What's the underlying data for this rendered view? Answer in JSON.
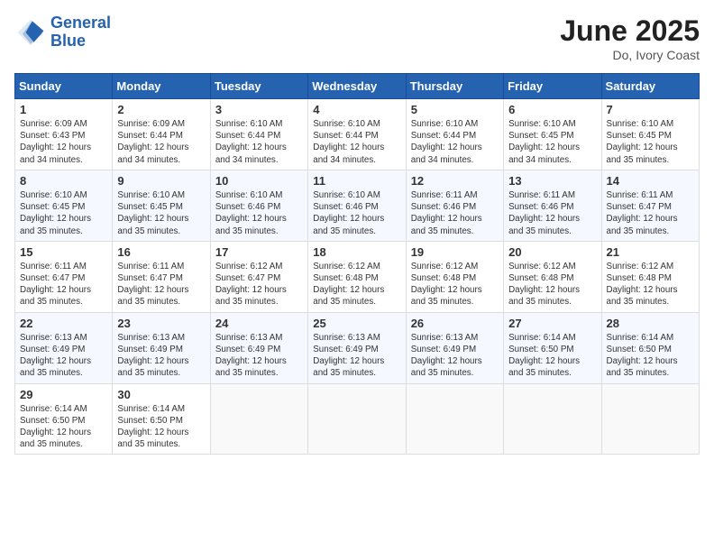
{
  "header": {
    "logo_line1": "General",
    "logo_line2": "Blue",
    "month": "June 2025",
    "location": "Do, Ivory Coast"
  },
  "weekdays": [
    "Sunday",
    "Monday",
    "Tuesday",
    "Wednesday",
    "Thursday",
    "Friday",
    "Saturday"
  ],
  "weeks": [
    [
      {
        "day": "1",
        "sunrise": "6:09 AM",
        "sunset": "6:43 PM",
        "daylight": "12 hours and 34 minutes."
      },
      {
        "day": "2",
        "sunrise": "6:09 AM",
        "sunset": "6:44 PM",
        "daylight": "12 hours and 34 minutes."
      },
      {
        "day": "3",
        "sunrise": "6:10 AM",
        "sunset": "6:44 PM",
        "daylight": "12 hours and 34 minutes."
      },
      {
        "day": "4",
        "sunrise": "6:10 AM",
        "sunset": "6:44 PM",
        "daylight": "12 hours and 34 minutes."
      },
      {
        "day": "5",
        "sunrise": "6:10 AM",
        "sunset": "6:44 PM",
        "daylight": "12 hours and 34 minutes."
      },
      {
        "day": "6",
        "sunrise": "6:10 AM",
        "sunset": "6:45 PM",
        "daylight": "12 hours and 34 minutes."
      },
      {
        "day": "7",
        "sunrise": "6:10 AM",
        "sunset": "6:45 PM",
        "daylight": "12 hours and 35 minutes."
      }
    ],
    [
      {
        "day": "8",
        "sunrise": "6:10 AM",
        "sunset": "6:45 PM",
        "daylight": "12 hours and 35 minutes."
      },
      {
        "day": "9",
        "sunrise": "6:10 AM",
        "sunset": "6:45 PM",
        "daylight": "12 hours and 35 minutes."
      },
      {
        "day": "10",
        "sunrise": "6:10 AM",
        "sunset": "6:46 PM",
        "daylight": "12 hours and 35 minutes."
      },
      {
        "day": "11",
        "sunrise": "6:10 AM",
        "sunset": "6:46 PM",
        "daylight": "12 hours and 35 minutes."
      },
      {
        "day": "12",
        "sunrise": "6:11 AM",
        "sunset": "6:46 PM",
        "daylight": "12 hours and 35 minutes."
      },
      {
        "day": "13",
        "sunrise": "6:11 AM",
        "sunset": "6:46 PM",
        "daylight": "12 hours and 35 minutes."
      },
      {
        "day": "14",
        "sunrise": "6:11 AM",
        "sunset": "6:47 PM",
        "daylight": "12 hours and 35 minutes."
      }
    ],
    [
      {
        "day": "15",
        "sunrise": "6:11 AM",
        "sunset": "6:47 PM",
        "daylight": "12 hours and 35 minutes."
      },
      {
        "day": "16",
        "sunrise": "6:11 AM",
        "sunset": "6:47 PM",
        "daylight": "12 hours and 35 minutes."
      },
      {
        "day": "17",
        "sunrise": "6:12 AM",
        "sunset": "6:47 PM",
        "daylight": "12 hours and 35 minutes."
      },
      {
        "day": "18",
        "sunrise": "6:12 AM",
        "sunset": "6:48 PM",
        "daylight": "12 hours and 35 minutes."
      },
      {
        "day": "19",
        "sunrise": "6:12 AM",
        "sunset": "6:48 PM",
        "daylight": "12 hours and 35 minutes."
      },
      {
        "day": "20",
        "sunrise": "6:12 AM",
        "sunset": "6:48 PM",
        "daylight": "12 hours and 35 minutes."
      },
      {
        "day": "21",
        "sunrise": "6:12 AM",
        "sunset": "6:48 PM",
        "daylight": "12 hours and 35 minutes."
      }
    ],
    [
      {
        "day": "22",
        "sunrise": "6:13 AM",
        "sunset": "6:49 PM",
        "daylight": "12 hours and 35 minutes."
      },
      {
        "day": "23",
        "sunrise": "6:13 AM",
        "sunset": "6:49 PM",
        "daylight": "12 hours and 35 minutes."
      },
      {
        "day": "24",
        "sunrise": "6:13 AM",
        "sunset": "6:49 PM",
        "daylight": "12 hours and 35 minutes."
      },
      {
        "day": "25",
        "sunrise": "6:13 AM",
        "sunset": "6:49 PM",
        "daylight": "12 hours and 35 minutes."
      },
      {
        "day": "26",
        "sunrise": "6:13 AM",
        "sunset": "6:49 PM",
        "daylight": "12 hours and 35 minutes."
      },
      {
        "day": "27",
        "sunrise": "6:14 AM",
        "sunset": "6:50 PM",
        "daylight": "12 hours and 35 minutes."
      },
      {
        "day": "28",
        "sunrise": "6:14 AM",
        "sunset": "6:50 PM",
        "daylight": "12 hours and 35 minutes."
      }
    ],
    [
      {
        "day": "29",
        "sunrise": "6:14 AM",
        "sunset": "6:50 PM",
        "daylight": "12 hours and 35 minutes."
      },
      {
        "day": "30",
        "sunrise": "6:14 AM",
        "sunset": "6:50 PM",
        "daylight": "12 hours and 35 minutes."
      },
      null,
      null,
      null,
      null,
      null
    ]
  ]
}
